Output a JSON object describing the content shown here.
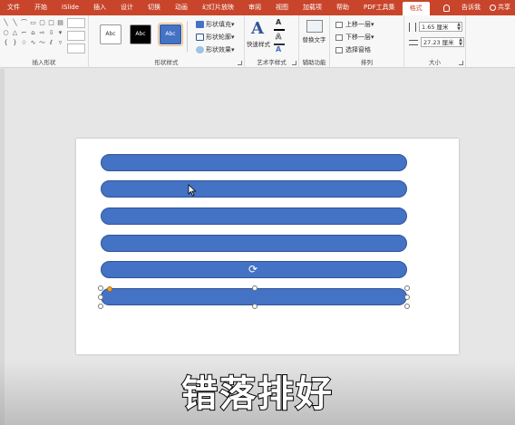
{
  "menu": {
    "items": [
      "文件",
      "开始",
      "iSlide",
      "插入",
      "设计",
      "切换",
      "动画",
      "幻灯片放映",
      "审阅",
      "视图",
      "加载项",
      "帮助",
      "PDF工具集",
      "格式"
    ],
    "tell_me": "告诉我",
    "share": "共享"
  },
  "ribbon": {
    "insert_shapes": {
      "label": "插入形状"
    },
    "shape_styles": {
      "label": "形状样式",
      "preset_text": "Abc",
      "fill": "形状填充",
      "outline": "形状轮廓",
      "effects": "形状效果"
    },
    "wordart": {
      "label": "艺术字样式",
      "quick_styles": "快速样式",
      "font_letter": "A"
    },
    "accessibility": {
      "label": "辅助功能",
      "alt_text": "替换文字"
    },
    "arrange": {
      "label": "排列",
      "bring_forward": "上移一层",
      "send_backward": "下移一层",
      "selection_pane": "选择窗格"
    },
    "size": {
      "label": "大小",
      "height": "1.65 厘米",
      "width": "27.23 厘米"
    }
  },
  "subtitle": "错落排好",
  "colors": {
    "accent": "#c8452b",
    "shape_fill": "#4472c4",
    "shape_border": "#2f5597"
  },
  "icons": [
    "bulb-icon",
    "person-icon",
    "rotate-icon",
    "cursor-icon"
  ]
}
